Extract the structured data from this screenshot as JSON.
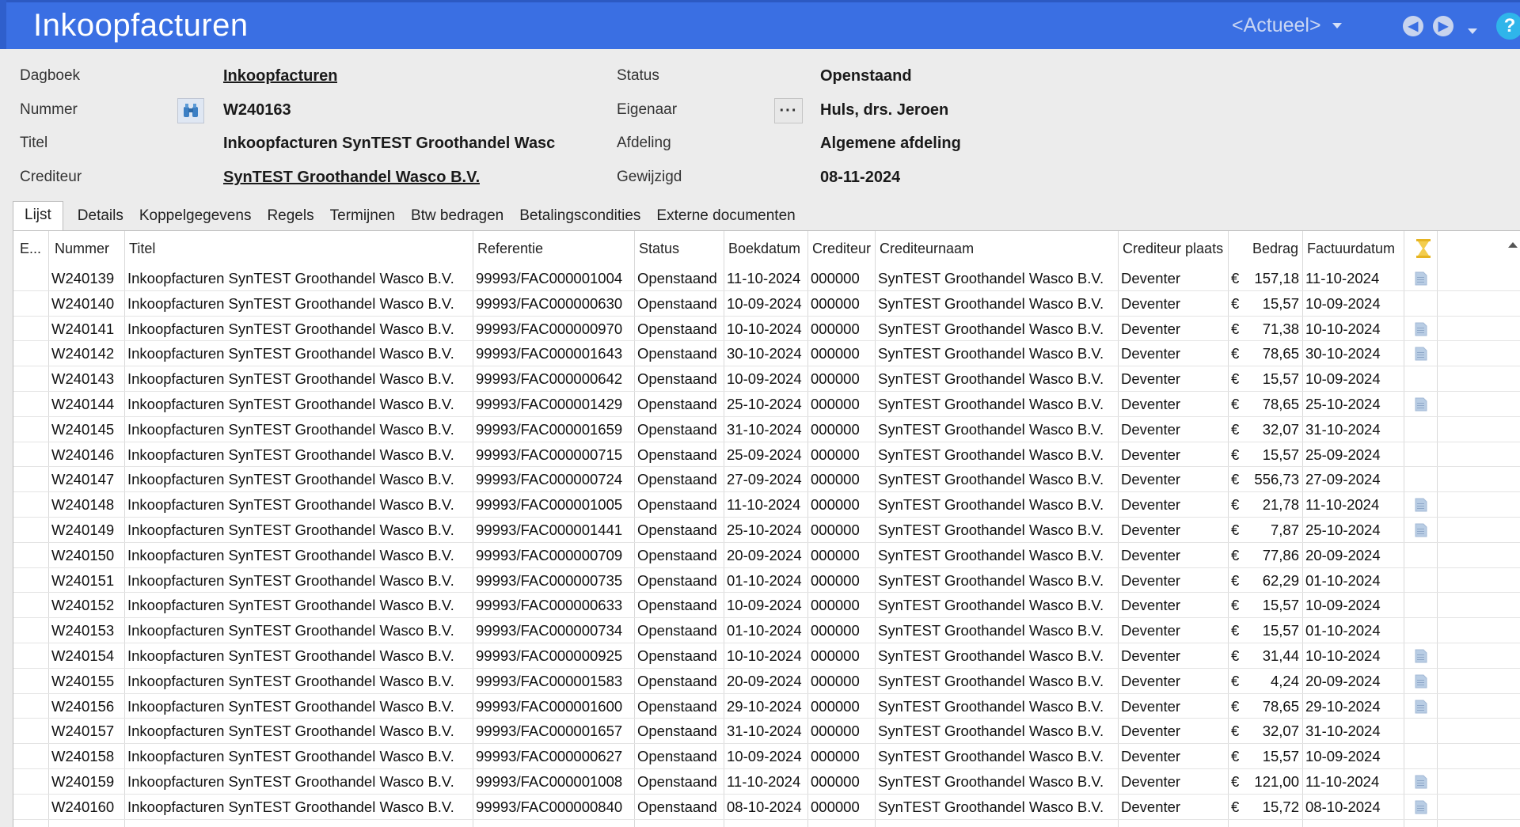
{
  "app": {
    "title": "Inkoopfacturen",
    "period": "<Actueel>",
    "help": "?"
  },
  "form": {
    "dagboek_label": "Dagboek",
    "dagboek_value": "Inkoopfacturen",
    "nummer_label": "Nummer",
    "nummer_value": "W240163",
    "titel_label": "Titel",
    "titel_value": "Inkoopfacturen SynTEST Groothandel Wasc",
    "crediteur_label": "Crediteur",
    "crediteur_value": "SynTEST Groothandel Wasco B.V.",
    "status_label": "Status",
    "status_value": "Openstaand",
    "eigenaar_label": "Eigenaar",
    "eigenaar_value": "Huls, drs. Jeroen",
    "eigenaar_button": "···",
    "afdeling_label": "Afdeling",
    "afdeling_value": "Algemene afdeling",
    "gewijzigd_label": "Gewijzigd",
    "gewijzigd_value": "08-11-2024"
  },
  "tabs": [
    "Lijst",
    "Details",
    "Koppelgegevens",
    "Regels",
    "Termijnen",
    "Btw bedragen",
    "Betalingscondities",
    "Externe documenten"
  ],
  "grid": {
    "columns": {
      "e": "E...",
      "nummer": "Nummer",
      "titel": "Titel",
      "referentie": "Referentie",
      "status": "Status",
      "boekdatum": "Boekdatum",
      "crediteur": "Crediteur",
      "crediteurnaam": "Crediteurnaam",
      "crediteur_plaats": "Crediteur plaats",
      "bedrag": "Bedrag",
      "factuurdatum": "Factuurdatum"
    },
    "rows": [
      {
        "nummer": "W240139",
        "titel": "Inkoopfacturen SynTEST Groothandel Wasco B.V.",
        "referentie": "99993/FAC000001004",
        "status": "Openstaand",
        "boekdatum": "11-10-2024",
        "crediteur": "000000",
        "crediteurnaam": "SynTEST Groothandel Wasco B.V.",
        "plaats": "Deventer",
        "valuta": "€",
        "bedrag": "157,18",
        "factuurdatum": "11-10-2024",
        "doc": true
      },
      {
        "nummer": "W240140",
        "titel": "Inkoopfacturen SynTEST Groothandel Wasco B.V.",
        "referentie": "99993/FAC000000630",
        "status": "Openstaand",
        "boekdatum": "10-09-2024",
        "crediteur": "000000",
        "crediteurnaam": "SynTEST Groothandel Wasco B.V.",
        "plaats": "Deventer",
        "valuta": "€",
        "bedrag": "15,57",
        "factuurdatum": "10-09-2024",
        "doc": false
      },
      {
        "nummer": "W240141",
        "titel": "Inkoopfacturen SynTEST Groothandel Wasco B.V.",
        "referentie": "99993/FAC000000970",
        "status": "Openstaand",
        "boekdatum": "10-10-2024",
        "crediteur": "000000",
        "crediteurnaam": "SynTEST Groothandel Wasco B.V.",
        "plaats": "Deventer",
        "valuta": "€",
        "bedrag": "71,38",
        "factuurdatum": "10-10-2024",
        "doc": true
      },
      {
        "nummer": "W240142",
        "titel": "Inkoopfacturen SynTEST Groothandel Wasco B.V.",
        "referentie": "99993/FAC000001643",
        "status": "Openstaand",
        "boekdatum": "30-10-2024",
        "crediteur": "000000",
        "crediteurnaam": "SynTEST Groothandel Wasco B.V.",
        "plaats": "Deventer",
        "valuta": "€",
        "bedrag": "78,65",
        "factuurdatum": "30-10-2024",
        "doc": true
      },
      {
        "nummer": "W240143",
        "titel": "Inkoopfacturen SynTEST Groothandel Wasco B.V.",
        "referentie": "99993/FAC000000642",
        "status": "Openstaand",
        "boekdatum": "10-09-2024",
        "crediteur": "000000",
        "crediteurnaam": "SynTEST Groothandel Wasco B.V.",
        "plaats": "Deventer",
        "valuta": "€",
        "bedrag": "15,57",
        "factuurdatum": "10-09-2024",
        "doc": false
      },
      {
        "nummer": "W240144",
        "titel": "Inkoopfacturen SynTEST Groothandel Wasco B.V.",
        "referentie": "99993/FAC000001429",
        "status": "Openstaand",
        "boekdatum": "25-10-2024",
        "crediteur": "000000",
        "crediteurnaam": "SynTEST Groothandel Wasco B.V.",
        "plaats": "Deventer",
        "valuta": "€",
        "bedrag": "78,65",
        "factuurdatum": "25-10-2024",
        "doc": true
      },
      {
        "nummer": "W240145",
        "titel": "Inkoopfacturen SynTEST Groothandel Wasco B.V.",
        "referentie": "99993/FAC000001659",
        "status": "Openstaand",
        "boekdatum": "31-10-2024",
        "crediteur": "000000",
        "crediteurnaam": "SynTEST Groothandel Wasco B.V.",
        "plaats": "Deventer",
        "valuta": "€",
        "bedrag": "32,07",
        "factuurdatum": "31-10-2024",
        "doc": false
      },
      {
        "nummer": "W240146",
        "titel": "Inkoopfacturen SynTEST Groothandel Wasco B.V.",
        "referentie": "99993/FAC000000715",
        "status": "Openstaand",
        "boekdatum": "25-09-2024",
        "crediteur": "000000",
        "crediteurnaam": "SynTEST Groothandel Wasco B.V.",
        "plaats": "Deventer",
        "valuta": "€",
        "bedrag": "15,57",
        "factuurdatum": "25-09-2024",
        "doc": false
      },
      {
        "nummer": "W240147",
        "titel": "Inkoopfacturen SynTEST Groothandel Wasco B.V.",
        "referentie": "99993/FAC000000724",
        "status": "Openstaand",
        "boekdatum": "27-09-2024",
        "crediteur": "000000",
        "crediteurnaam": "SynTEST Groothandel Wasco B.V.",
        "plaats": "Deventer",
        "valuta": "€",
        "bedrag": "556,73",
        "factuurdatum": "27-09-2024",
        "doc": false
      },
      {
        "nummer": "W240148",
        "titel": "Inkoopfacturen SynTEST Groothandel Wasco B.V.",
        "referentie": "99993/FAC000001005",
        "status": "Openstaand",
        "boekdatum": "11-10-2024",
        "crediteur": "000000",
        "crediteurnaam": "SynTEST Groothandel Wasco B.V.",
        "plaats": "Deventer",
        "valuta": "€",
        "bedrag": "21,78",
        "factuurdatum": "11-10-2024",
        "doc": true
      },
      {
        "nummer": "W240149",
        "titel": "Inkoopfacturen SynTEST Groothandel Wasco B.V.",
        "referentie": "99993/FAC000001441",
        "status": "Openstaand",
        "boekdatum": "25-10-2024",
        "crediteur": "000000",
        "crediteurnaam": "SynTEST Groothandel Wasco B.V.",
        "plaats": "Deventer",
        "valuta": "€",
        "bedrag": "7,87",
        "factuurdatum": "25-10-2024",
        "doc": true
      },
      {
        "nummer": "W240150",
        "titel": "Inkoopfacturen SynTEST Groothandel Wasco B.V.",
        "referentie": "99993/FAC000000709",
        "status": "Openstaand",
        "boekdatum": "20-09-2024",
        "crediteur": "000000",
        "crediteurnaam": "SynTEST Groothandel Wasco B.V.",
        "plaats": "Deventer",
        "valuta": "€",
        "bedrag": "77,86",
        "factuurdatum": "20-09-2024",
        "doc": false
      },
      {
        "nummer": "W240151",
        "titel": "Inkoopfacturen SynTEST Groothandel Wasco B.V.",
        "referentie": "99993/FAC000000735",
        "status": "Openstaand",
        "boekdatum": "01-10-2024",
        "crediteur": "000000",
        "crediteurnaam": "SynTEST Groothandel Wasco B.V.",
        "plaats": "Deventer",
        "valuta": "€",
        "bedrag": "62,29",
        "factuurdatum": "01-10-2024",
        "doc": false
      },
      {
        "nummer": "W240152",
        "titel": "Inkoopfacturen SynTEST Groothandel Wasco B.V.",
        "referentie": "99993/FAC000000633",
        "status": "Openstaand",
        "boekdatum": "10-09-2024",
        "crediteur": "000000",
        "crediteurnaam": "SynTEST Groothandel Wasco B.V.",
        "plaats": "Deventer",
        "valuta": "€",
        "bedrag": "15,57",
        "factuurdatum": "10-09-2024",
        "doc": false
      },
      {
        "nummer": "W240153",
        "titel": "Inkoopfacturen SynTEST Groothandel Wasco B.V.",
        "referentie": "99993/FAC000000734",
        "status": "Openstaand",
        "boekdatum": "01-10-2024",
        "crediteur": "000000",
        "crediteurnaam": "SynTEST Groothandel Wasco B.V.",
        "plaats": "Deventer",
        "valuta": "€",
        "bedrag": "15,57",
        "factuurdatum": "01-10-2024",
        "doc": false
      },
      {
        "nummer": "W240154",
        "titel": "Inkoopfacturen SynTEST Groothandel Wasco B.V.",
        "referentie": "99993/FAC000000925",
        "status": "Openstaand",
        "boekdatum": "10-10-2024",
        "crediteur": "000000",
        "crediteurnaam": "SynTEST Groothandel Wasco B.V.",
        "plaats": "Deventer",
        "valuta": "€",
        "bedrag": "31,44",
        "factuurdatum": "10-10-2024",
        "doc": true
      },
      {
        "nummer": "W240155",
        "titel": "Inkoopfacturen SynTEST Groothandel Wasco B.V.",
        "referentie": "99993/FAC000001583",
        "status": "Openstaand",
        "boekdatum": "20-09-2024",
        "crediteur": "000000",
        "crediteurnaam": "SynTEST Groothandel Wasco B.V.",
        "plaats": "Deventer",
        "valuta": "€",
        "bedrag": "4,24",
        "factuurdatum": "20-09-2024",
        "doc": true
      },
      {
        "nummer": "W240156",
        "titel": "Inkoopfacturen SynTEST Groothandel Wasco B.V.",
        "referentie": "99993/FAC000001600",
        "status": "Openstaand",
        "boekdatum": "29-10-2024",
        "crediteur": "000000",
        "crediteurnaam": "SynTEST Groothandel Wasco B.V.",
        "plaats": "Deventer",
        "valuta": "€",
        "bedrag": "78,65",
        "factuurdatum": "29-10-2024",
        "doc": true
      },
      {
        "nummer": "W240157",
        "titel": "Inkoopfacturen SynTEST Groothandel Wasco B.V.",
        "referentie": "99993/FAC000001657",
        "status": "Openstaand",
        "boekdatum": "31-10-2024",
        "crediteur": "000000",
        "crediteurnaam": "SynTEST Groothandel Wasco B.V.",
        "plaats": "Deventer",
        "valuta": "€",
        "bedrag": "32,07",
        "factuurdatum": "31-10-2024",
        "doc": false
      },
      {
        "nummer": "W240158",
        "titel": "Inkoopfacturen SynTEST Groothandel Wasco B.V.",
        "referentie": "99993/FAC000000627",
        "status": "Openstaand",
        "boekdatum": "10-09-2024",
        "crediteur": "000000",
        "crediteurnaam": "SynTEST Groothandel Wasco B.V.",
        "plaats": "Deventer",
        "valuta": "€",
        "bedrag": "15,57",
        "factuurdatum": "10-09-2024",
        "doc": false
      },
      {
        "nummer": "W240159",
        "titel": "Inkoopfacturen SynTEST Groothandel Wasco B.V.",
        "referentie": "99993/FAC000001008",
        "status": "Openstaand",
        "boekdatum": "11-10-2024",
        "crediteur": "000000",
        "crediteurnaam": "SynTEST Groothandel Wasco B.V.",
        "plaats": "Deventer",
        "valuta": "€",
        "bedrag": "121,00",
        "factuurdatum": "11-10-2024",
        "doc": true
      },
      {
        "nummer": "W240160",
        "titel": "Inkoopfacturen SynTEST Groothandel Wasco B.V.",
        "referentie": "99993/FAC000000840",
        "status": "Openstaand",
        "boekdatum": "08-10-2024",
        "crediteur": "000000",
        "crediteurnaam": "SynTEST Groothandel Wasco B.V.",
        "plaats": "Deventer",
        "valuta": "€",
        "bedrag": "15,72",
        "factuurdatum": "08-10-2024",
        "doc": true
      }
    ]
  },
  "icons": {
    "hourglass_color": "#e6b422",
    "doc_icon_color": "#b9cde4",
    "lookup_icon_color": "#3c7fc4"
  }
}
